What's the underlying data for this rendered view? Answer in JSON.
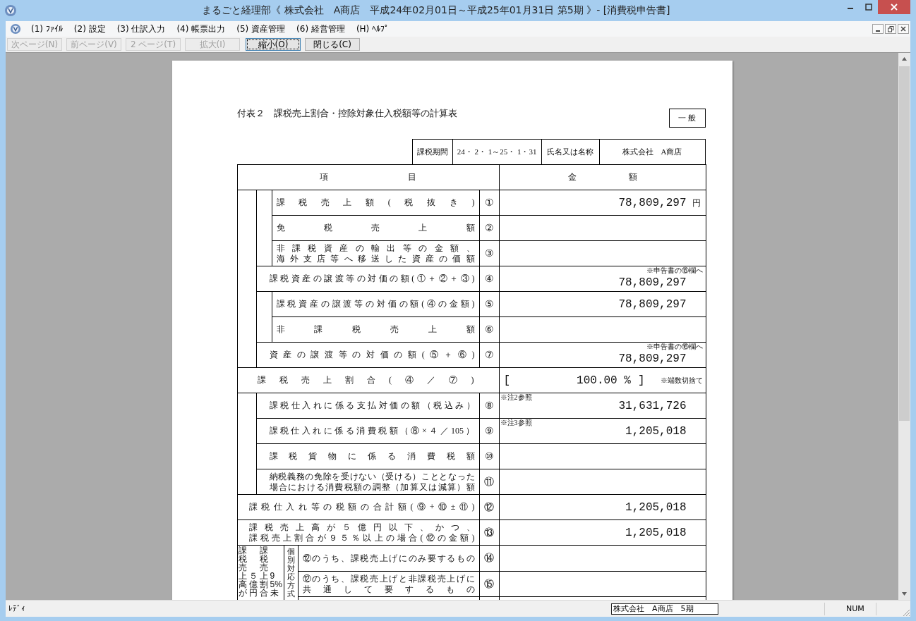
{
  "window": {
    "title": "まるごと経理部《 株式会社　A商店　平成24年02月01日～平成25年01月31日 第5期 》- [消費税申告書]"
  },
  "menu": [
    "(1) ﾌｧｲﾙ",
    "(2) 設定",
    "(3) 仕訳入力",
    "(4) 帳票出力",
    "(5) 資産管理",
    "(6) 経営管理",
    "(H) ﾍﾙﾌﾟ"
  ],
  "toolbar": [
    {
      "label": "次ページ(N)",
      "disabled": true,
      "focused": false
    },
    {
      "label": "前ページ(V)",
      "disabled": true,
      "focused": false
    },
    {
      "label": "2 ページ(T)",
      "disabled": true,
      "focused": false
    },
    {
      "label": "拡大(I)",
      "disabled": true,
      "focused": false
    },
    {
      "label": "縮小(O)",
      "disabled": false,
      "focused": true
    },
    {
      "label": "閉じる(C)",
      "disabled": false,
      "focused": false
    }
  ],
  "form": {
    "title": "付表２　課税売上割合・控除対象仕入税額等の計算表",
    "badge": "一 般",
    "period_label": "課税期間",
    "period": "24・ 2・ 1～25・ 1・31",
    "name_label": "氏名又は名称",
    "name": "株式会社　A商店",
    "item_heading": [
      "項",
      "目"
    ],
    "amount_heading": [
      "金",
      "額"
    ],
    "rows": [
      {
        "kind": "item2",
        "label": [
          "課税売上額(税抜き)"
        ],
        "no": "①",
        "amount": "78,809,297",
        "unit": "円"
      },
      {
        "kind": "item2",
        "label": [
          "免税売上額"
        ],
        "no": "②"
      },
      {
        "kind": "item2",
        "label": [
          "非課税資産の輸出等の金額、",
          "海外支店等へ移送した資産の価額"
        ],
        "no": "③"
      },
      {
        "kind": "item1",
        "label": [
          "課税資産の譲渡等の対価の額(①＋②＋③)"
        ],
        "no": "④",
        "amount": "78,809,297",
        "note": {
          "text": "※申告書の⑮欄へ",
          "kind": "corner"
        }
      },
      {
        "kind": "item2",
        "label": [
          "課税資産の譲渡等の対価の額(④の金額)"
        ],
        "no": "⑤",
        "amount": "78,809,297"
      },
      {
        "kind": "item2",
        "label": [
          "非課税売上額"
        ],
        "no": "⑥"
      },
      {
        "kind": "item1",
        "label": [
          "資産の譲渡等の対価の額(⑤＋⑥)"
        ],
        "no": "⑦",
        "amount": "78,809,297",
        "note": {
          "text": "※申告書の⑯欄へ",
          "kind": "corner"
        }
      },
      {
        "kind": "ratio",
        "label": [
          "課税売上割合(④／⑦)"
        ],
        "open": "[",
        "amount": "100.00 %",
        "close": "]",
        "note": {
          "text": "※端数切捨て",
          "kind": "inline"
        }
      },
      {
        "kind": "item1",
        "label": [
          "課税仕入れに係る支払対価の額（税込み）"
        ],
        "no": "⑧",
        "amount": "31,631,726",
        "note": {
          "text": "※注2参照",
          "kind": "tag"
        }
      },
      {
        "kind": "item1",
        "label": [
          "課税仕入れに係る消費税額（⑧×４／105）"
        ],
        "no": "⑨",
        "amount": "1,205,018",
        "note": {
          "text": "※注3参照",
          "kind": "tag"
        }
      },
      {
        "kind": "item1",
        "label": [
          "課税貨物に係る消費税額"
        ],
        "no": "⑩"
      },
      {
        "kind": "item1",
        "label": [
          "納税義務の免除を受けない（受ける）こととなった",
          "場合における消費税額の調整（加算又は減算）額"
        ],
        "no": "⑪"
      },
      {
        "kind": "item0",
        "label": [
          "課税仕入れ等の税額の合計額(⑨+⑩±⑪)"
        ],
        "no": "⑫",
        "amount": "1,205,018"
      },
      {
        "kind": "item0",
        "label": [
          "課税売上高が５億円以下、かつ、",
          "課税売上割合が９５％以上の場合(⑫の金額)"
        ],
        "no": "⑬",
        "amount": "1,205,018"
      }
    ],
    "bottom": {
      "side_columns": [
        "課税売上高が",
        "５億円",
        "課税売上割合",
        "95%未"
      ],
      "method": "個別対応方式",
      "rows": [
        {
          "label": [
            "⑫のうち、課税売上げにのみ要するもの"
          ],
          "no": "⑭"
        },
        {
          "label": [
            "⑫のうち、課税売上げと非課税売上げに",
            "共通して要するもの"
          ],
          "no": "⑮"
        }
      ]
    }
  },
  "status_bar": {
    "state": "ﾚﾃﾞｨ",
    "company": "株式会社　A商店　5期",
    "num": "NUM"
  }
}
